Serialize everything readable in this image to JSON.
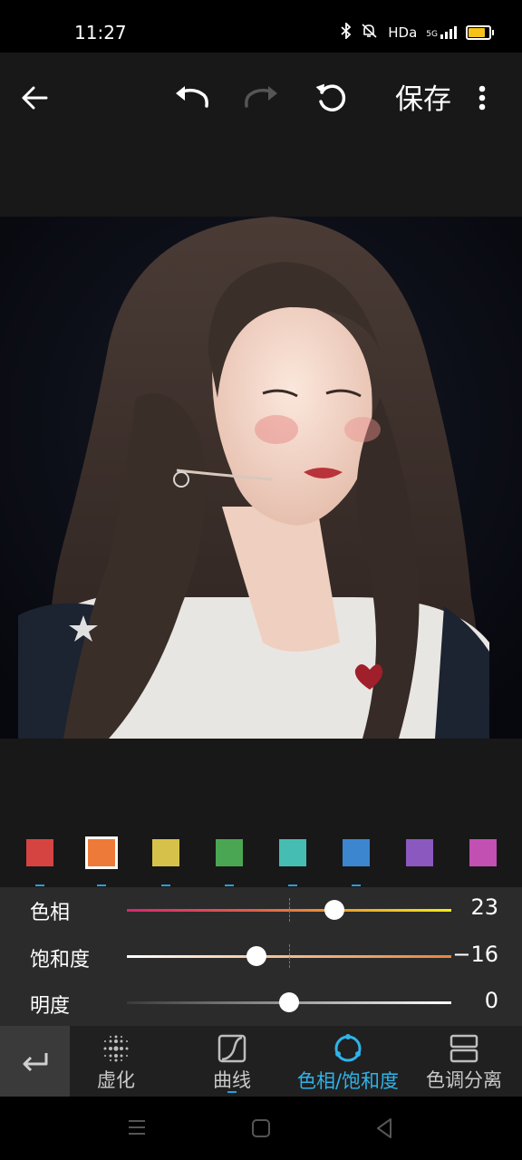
{
  "status_bar": {
    "time": "11:27",
    "network": "HDa",
    "signal": "5G"
  },
  "toolbar": {
    "save_label": "保存"
  },
  "colors": {
    "swatches": [
      "#d64442",
      "#ee7a3a",
      "#d6c24a",
      "#4aa652",
      "#46bdb2",
      "#3c86d0",
      "#8b58c0",
      "#c250b2"
    ],
    "selected_swatch_index": 1,
    "accent": "#2fb3ea"
  },
  "adjustments": [
    {
      "label": "色相",
      "value": "23",
      "level": 0.64
    },
    {
      "label": "饱和度",
      "value": "−16",
      "level": 0.4
    },
    {
      "label": "明度",
      "value": "0",
      "level": 0.5
    }
  ],
  "tools": [
    {
      "label": "虚化",
      "icon": "blur-icon"
    },
    {
      "label": "曲线",
      "icon": "curves-icon"
    },
    {
      "label": "色相/饱和度",
      "icon": "hue-saturation-icon"
    },
    {
      "label": "色调分离",
      "icon": "split-toning-icon"
    }
  ],
  "active_tool_index": 2
}
